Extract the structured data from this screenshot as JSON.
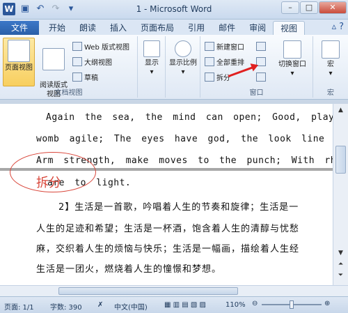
{
  "window": {
    "title": "1 - Microsoft Word",
    "controls": [
      "–",
      "□",
      "✕"
    ]
  },
  "qat": {
    "logo": "W",
    "icons": [
      "save-icon",
      "undo-icon",
      "redo-icon",
      "dropdown-icon"
    ]
  },
  "tabs": [
    {
      "label": "文件"
    },
    {
      "label": "开始"
    },
    {
      "label": "朗读"
    },
    {
      "label": "插入"
    },
    {
      "label": "页面布局"
    },
    {
      "label": "引用"
    },
    {
      "label": "邮件"
    },
    {
      "label": "审阅"
    },
    {
      "label": "视图"
    }
  ],
  "ribbon": {
    "doc_views": {
      "print_layout": "页面视图",
      "reading_layout": "阅读版式\n视图",
      "web_layout": "Web 版式视图",
      "outline": "大纲视图",
      "draft": "草稿",
      "group_label": "文档视图"
    },
    "show": {
      "label": "显示"
    },
    "zoom": {
      "label": "显示比例"
    },
    "window": {
      "new_window": "新建窗口",
      "arrange_all": "全部重排",
      "split": "拆分",
      "switch": "切换窗口",
      "group_label": "窗口"
    },
    "macros": {
      "label": "宏",
      "group_label": "宏"
    }
  },
  "document": {
    "lines": [
      "Again the sea, the mind can open; Good, play",
      "womb agile; The eyes have god, the look line",
      "Arm strength, make moves to the punch; With rh",
      "are to light.",
      "2】生活是一首歌，吟唱着人生的节奏和旋律；生活是一",
      "人生的足迹和希望；生活是一杯酒，饱含着人生的清醇与忧愁",
      "麻，交织着人生的烦恼与快乐；生活是一幅画，描绘着人生经",
      "生活是一团火，燃烧着人生的憧憬和梦想。"
    ],
    "annotation": "拆分"
  },
  "status": {
    "page": "页面: 1/1",
    "words": "字数: 390",
    "language": "中文(中国)",
    "zoom": "110%"
  }
}
